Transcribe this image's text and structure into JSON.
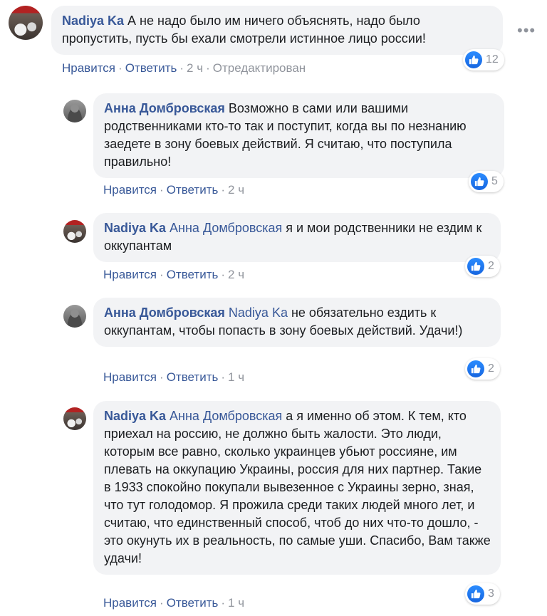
{
  "actions": {
    "like": "Нравится",
    "reply": "Ответить",
    "separator": "·"
  },
  "comments": [
    {
      "author": "Nadiya Ka",
      "mention": "",
      "text": " А не надо было им ничего объяснять, надо было пропустить, пусть бы ехали смотрели истинное лицо россии!",
      "time": "2 ч",
      "edited": "Отредактирован",
      "likes": "12"
    },
    {
      "author": "Анна Домбровская",
      "mention": "",
      "text": " Возможно в сами или вашими родственниками кто-то так и поступит, когда вы по незнанию заедете в зону боевых действий. Я считаю, что поступила правильно!",
      "time": "2 ч",
      "likes": "5"
    },
    {
      "author": "Nadiya Ka",
      "mention": " Анна Домбровская",
      "text": " я и мои родственники не ездим к оккупантам",
      "time": "2 ч",
      "likes": "2"
    },
    {
      "author": "Анна Домбровская",
      "mention": " Nadiya Ka",
      "text": " не обязательно ездить к оккупантам, чтобы попасть в зону боевых действий. Удачи!)",
      "time": "1 ч",
      "likes": "2"
    },
    {
      "author": "Nadiya Ka",
      "mention": " Анна Домбровская",
      "text": " а я именно об этом. К тем, кто приехал на россию, не должно быть жалости. Это люди, которым все равно, сколько украинцев убьют россияне, им плевать на оккупацию Украины, россия для них партнер. Такие в 1933 спокойно покупали вывезенное с Украины зерно, зная, что тут голодомор. Я прожила среди таких людей много лет, и считаю, что единственный способ, чтоб до них что-то дошло, - это окунуть их в реальность, по самые уши. Спасибо, Вам также удачи!",
      "time": "1 ч",
      "likes": "3"
    }
  ],
  "icons": {
    "like": "thumbs-up-icon",
    "more": "more-options-icon"
  },
  "colors": {
    "link": "#385898",
    "bubble": "#f2f3f5",
    "like_blue": "#1877f2",
    "meta": "#90949c"
  }
}
